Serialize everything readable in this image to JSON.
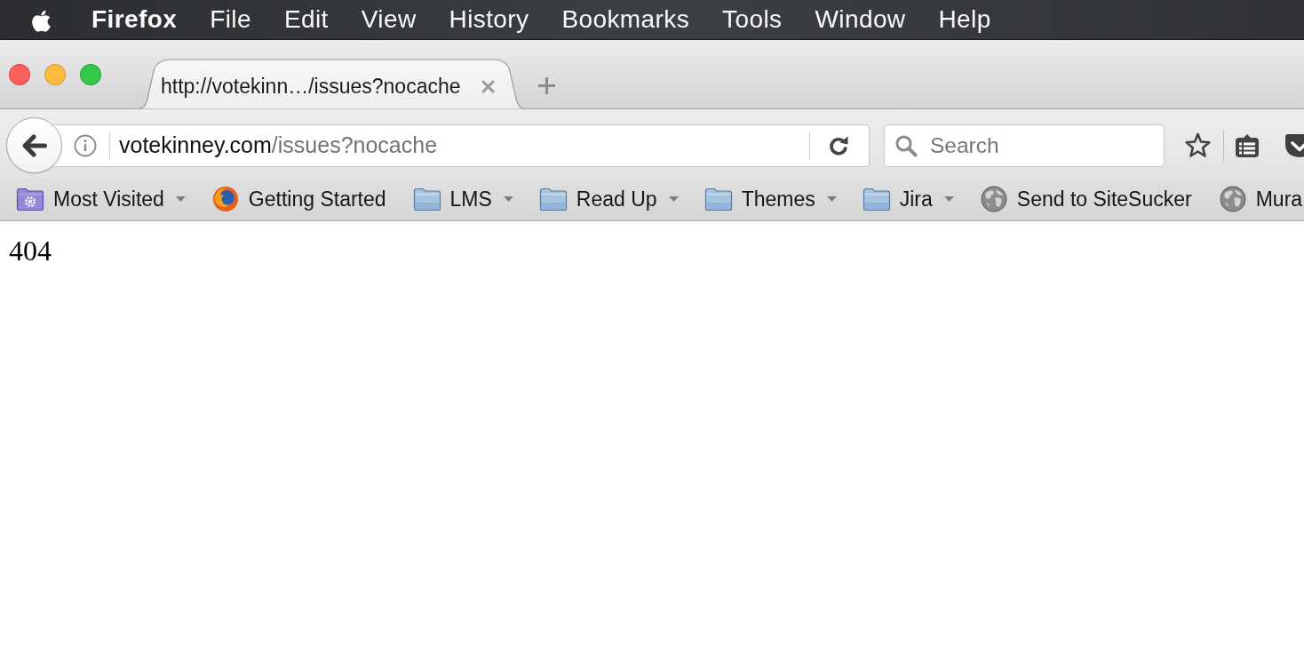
{
  "menu_bar": {
    "items": [
      {
        "label": "Firefox",
        "kind": "app"
      },
      {
        "label": "File",
        "kind": "menu"
      },
      {
        "label": "Edit",
        "kind": "menu"
      },
      {
        "label": "View",
        "kind": "menu"
      },
      {
        "label": "History",
        "kind": "menu"
      },
      {
        "label": "Bookmarks",
        "kind": "menu"
      },
      {
        "label": "Tools",
        "kind": "menu"
      },
      {
        "label": "Window",
        "kind": "menu"
      },
      {
        "label": "Help",
        "kind": "menu"
      }
    ]
  },
  "tabs": [
    {
      "title": "http://votekinn…/issues?nocache",
      "selected": true
    }
  ],
  "address_bar": {
    "host": "votekinney.com",
    "path": "/issues?nocache"
  },
  "search": {
    "placeholder": "Search"
  },
  "bookmarks": [
    {
      "label": "Most Visited",
      "kind": "smart-folder"
    },
    {
      "label": "Getting Started",
      "kind": "page"
    },
    {
      "label": "LMS",
      "kind": "folder"
    },
    {
      "label": "Read Up",
      "kind": "folder"
    },
    {
      "label": "Themes",
      "kind": "folder"
    },
    {
      "label": "Jira",
      "kind": "folder"
    },
    {
      "label": "Send to SiteSucker",
      "kind": "bookmarklet"
    },
    {
      "label": "Mura",
      "kind": "bookmarklet"
    }
  ],
  "page": {
    "text": "404"
  }
}
